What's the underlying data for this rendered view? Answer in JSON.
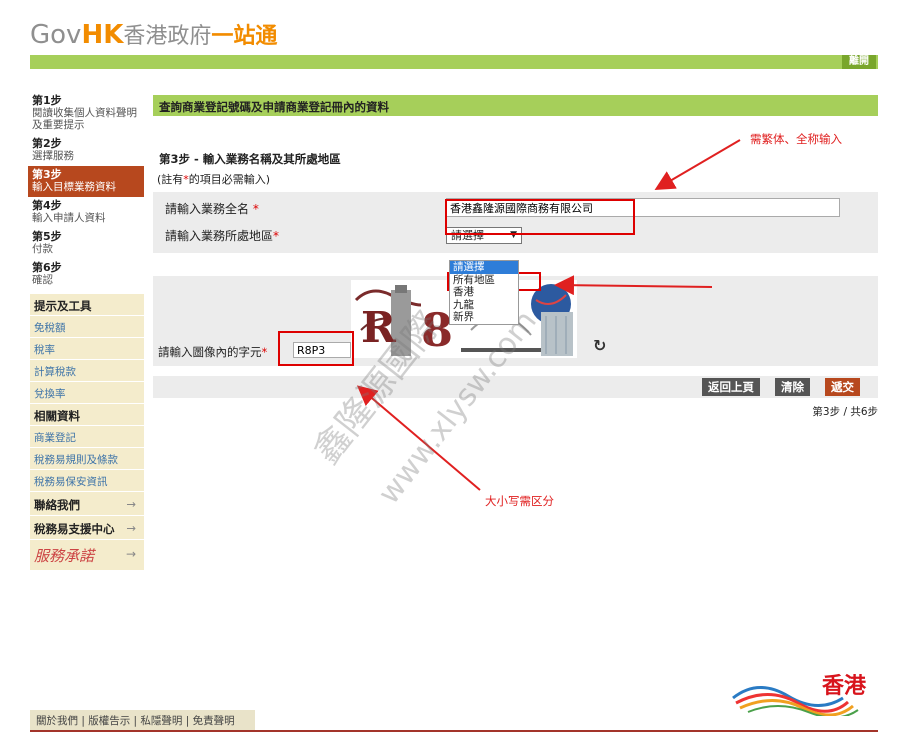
{
  "header": {
    "logo_gov": "Gov",
    "logo_hk": "HK",
    "logo_cn": "香港政府",
    "logo_one": "一站通",
    "leave_button": "離開"
  },
  "sidebar": {
    "steps": [
      {
        "num": "第1步",
        "label": "閱讀收集個人資料聲明及重要提示"
      },
      {
        "num": "第2步",
        "label": "選擇服務"
      },
      {
        "num": "第3步",
        "label": "輸入目標業務資料"
      },
      {
        "num": "第4步",
        "label": "輸入申請人資料"
      },
      {
        "num": "第5步",
        "label": "付款"
      },
      {
        "num": "第6步",
        "label": "確認"
      }
    ],
    "tools_title": "提示及工具",
    "tools": [
      "免稅額",
      "稅率",
      "計算稅款",
      "兌換率"
    ],
    "related_title": "相關資料",
    "related": [
      "商業登記",
      "稅務易規則及條款",
      "稅務易保安資訊"
    ],
    "contact": "聯絡我們",
    "help_center": "稅務易支援中心",
    "service_pledge": "服務承諾",
    "arrow": "→"
  },
  "main": {
    "title": "查詢商業登記號碼及申請商業登記冊內的資料",
    "step_heading": "第3步 - 輸入業務名稱及其所處地區",
    "note_prefix": "(註有",
    "note_star": "*",
    "note_suffix": "的項目必需輸入)",
    "business_name_label": "請輸入業務全名",
    "business_name_value": "香港鑫隆源國際商務有限公司",
    "region_label": "請輸入業務所處地區",
    "region_selected": "請選擇",
    "region_options": [
      "請選擇",
      "所有地區",
      "香港",
      "九龍",
      "新界"
    ],
    "captcha_label": "請輸入圖像內的字元",
    "captcha_value": "R8P3",
    "required_star": "*",
    "buttons": {
      "back": "返回上頁",
      "clear": "清除",
      "submit": "遞交"
    },
    "pager": "第3步 / 共6步"
  },
  "annotations": {
    "note_traditional": "需繁体、全称输入",
    "note_case": "大小写需区分",
    "watermark_1": "鑫隆源國際",
    "watermark_2": "www.xlysw.com"
  },
  "footer": {
    "links": "關於我們 | 版權告示 | 私隱聲明 | 免責聲明",
    "hk_brand": "香港"
  },
  "colors": {
    "green_bar": "#a6cf5a",
    "active_step": "#b7481e",
    "annotation_red": "#e02020",
    "brand_orange": "#f28c00"
  }
}
